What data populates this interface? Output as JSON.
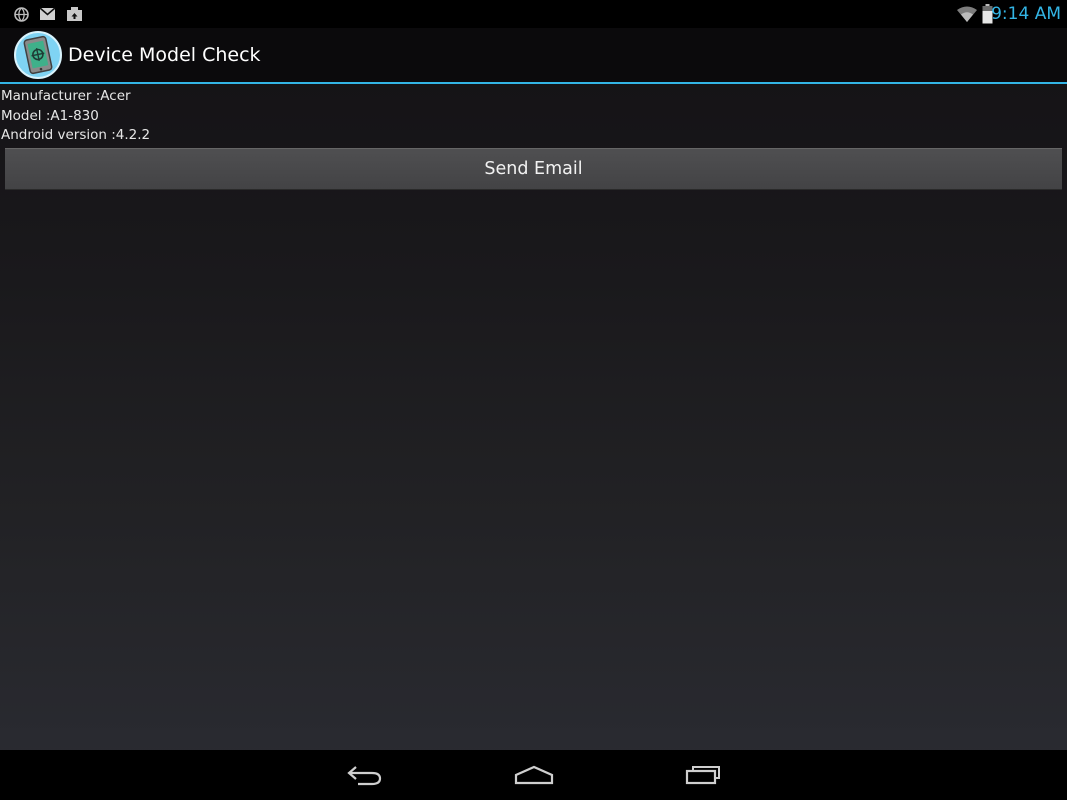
{
  "status_bar": {
    "time": "9:14 AM",
    "accent_color": "#33b5e5",
    "left_icons": [
      "network-icon",
      "gmail-icon",
      "camera-upload-icon"
    ],
    "right_icons": [
      "wifi-icon",
      "battery-icon"
    ]
  },
  "action_bar": {
    "title": "Device Model Check",
    "icon": "app-tablet-icon"
  },
  "device_info": {
    "manufacturer": "Manufacturer :Acer",
    "model": "Model :A1-830",
    "android_version": "Android version :4.2.2"
  },
  "buttons": {
    "send_email": "Send Email"
  },
  "nav_bar": {
    "icons": [
      "back-icon",
      "home-icon",
      "recent-apps-icon"
    ]
  }
}
